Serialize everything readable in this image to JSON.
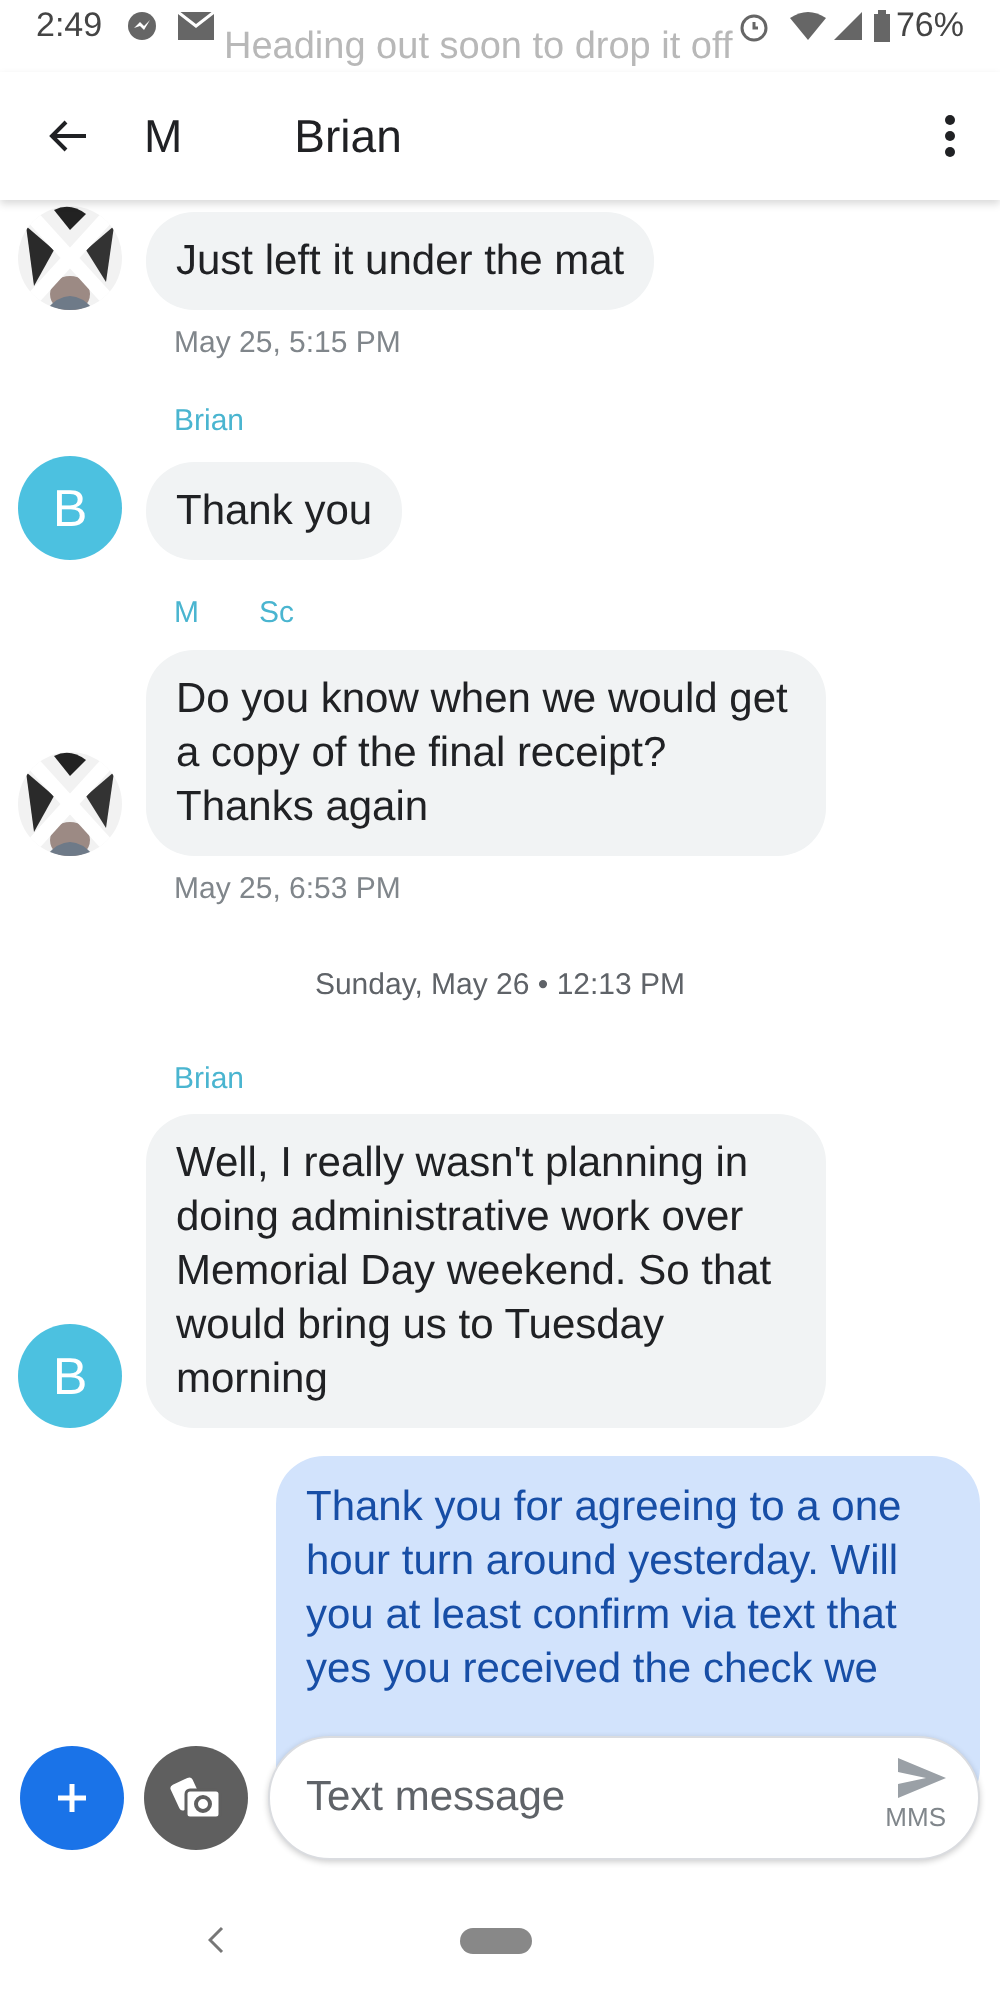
{
  "status_bar": {
    "time": "2:49",
    "battery": "76%"
  },
  "faded_message": "Heading out soon to drop it off",
  "header": {
    "title_parts": [
      "M",
      "Brian"
    ]
  },
  "messages": [
    {
      "kind": "incoming",
      "text": "Just left it under the mat",
      "timestamp": "May 25, 5:15 PM"
    },
    {
      "kind": "incoming",
      "avatar": {
        "kind": "letter",
        "letter": "B",
        "color": "#4cc1e0"
      },
      "sender_parts": [
        "Brian"
      ],
      "text": "Thank you"
    },
    {
      "kind": "incoming",
      "sender_parts": [
        "M",
        "Sc"
      ],
      "text": "Do you know when we would get a copy of the final receipt? Thanks again",
      "timestamp": "May 25, 6:53 PM"
    },
    {
      "kind": "divider",
      "text": "Sunday, May 26 • 12:13 PM"
    },
    {
      "kind": "incoming",
      "avatar": {
        "kind": "letter",
        "letter": "B",
        "color": "#4cc1e0"
      },
      "sender_parts": [
        "Brian"
      ],
      "text": "Well, I really wasn't planning in doing administrative work over Memorial Day weekend. So that would bring us to Tuesday morning"
    },
    {
      "kind": "outgoing",
      "text": "Thank you for agreeing to a one hour turn around yesterday. Will you at least confirm via text that yes you received the check we"
    }
  ],
  "composer": {
    "placeholder": "Text message",
    "send_label": "MMS"
  }
}
